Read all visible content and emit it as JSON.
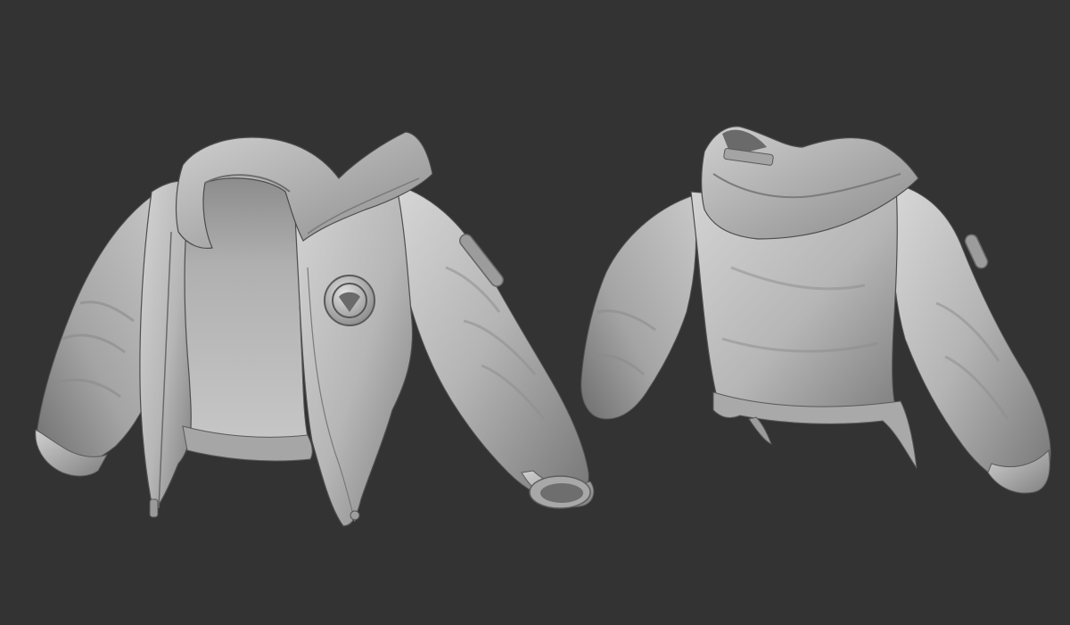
{
  "scene": {
    "background_color": "#333333",
    "material_color": "#b9b9b9",
    "shadow_color": "#4a4a4a",
    "highlight_color": "#e6e6e6"
  },
  "models": [
    {
      "id": "front",
      "subject": "jacket",
      "view": "front"
    },
    {
      "id": "back",
      "subject": "jacket",
      "view": "back"
    }
  ],
  "details": {
    "chest_badge_icon": "emblem-icon",
    "sleeve_pocket_icon": "zipper-pocket-icon"
  }
}
